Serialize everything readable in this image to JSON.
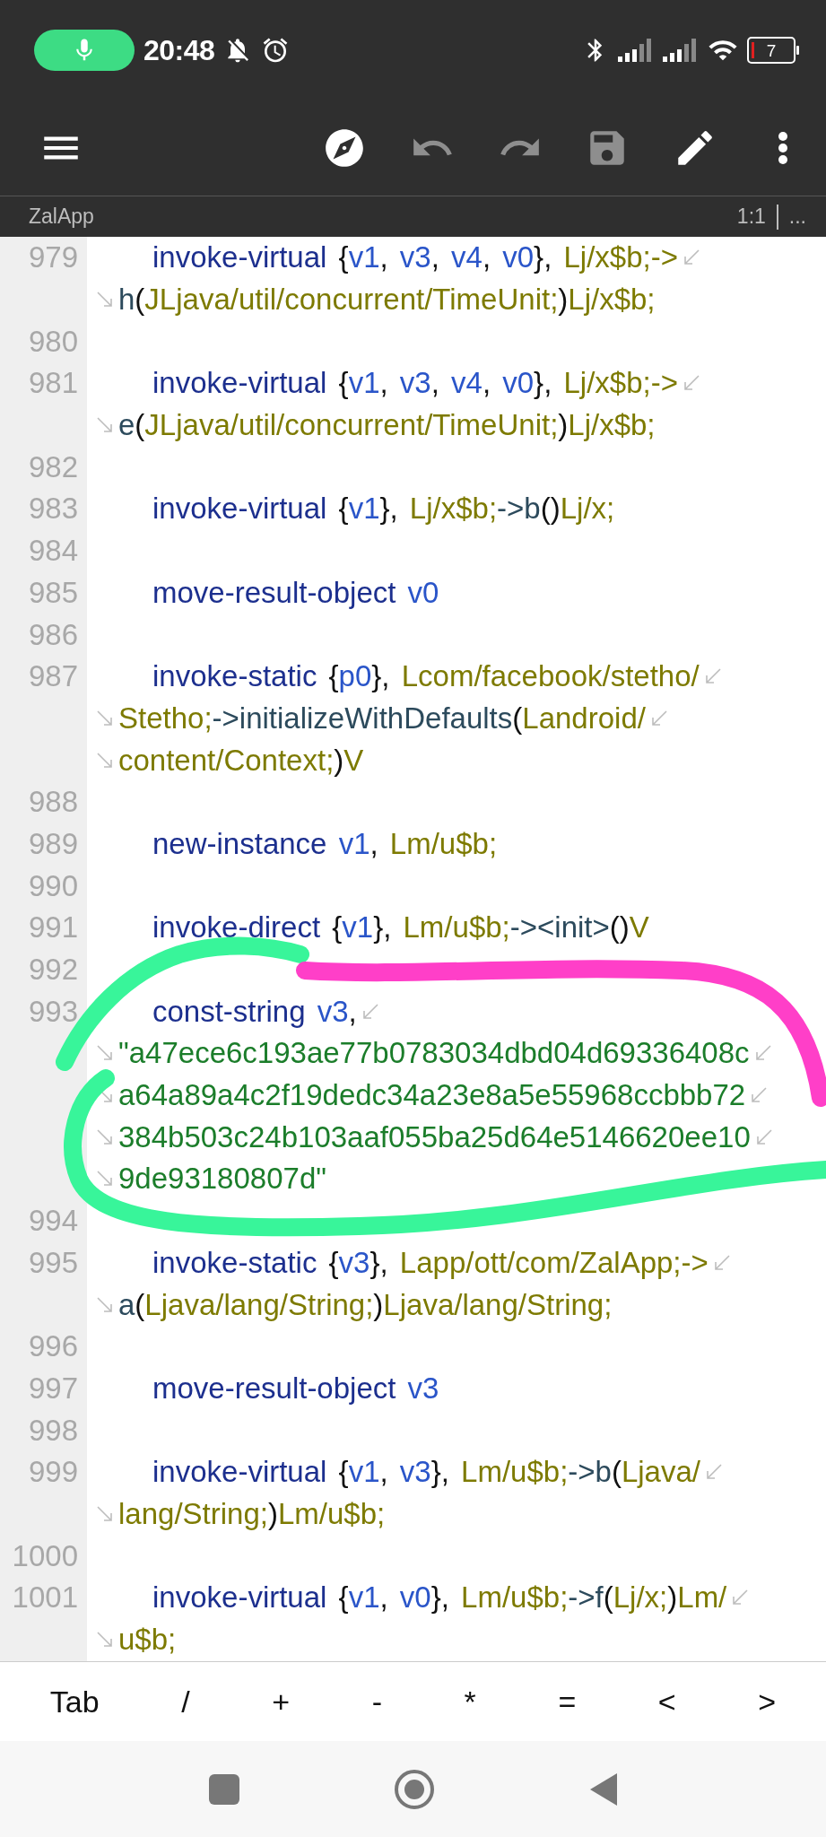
{
  "status_bar": {
    "time": "20:48",
    "battery": "7"
  },
  "toolbar": [
    {
      "kind": "menu",
      "disabled": false
    },
    {
      "kind": "compass",
      "disabled": false
    },
    {
      "kind": "undo",
      "disabled": true
    },
    {
      "kind": "redo",
      "disabled": true
    },
    {
      "kind": "save",
      "disabled": true
    },
    {
      "kind": "edit",
      "disabled": false
    },
    {
      "kind": "more",
      "disabled": false
    }
  ],
  "file_tab": {
    "title": "ZalApp",
    "position": "1:1",
    "more": "..."
  },
  "code": [
    {
      "number": "979",
      "rows": [
        "invoke-virtual {v1, v3, v4, v0}, Lj/x$b;->",
        "h(JLjava/util/concurrent/TimeUnit;)Lj/x$b;"
      ]
    },
    {
      "number": "980"
    },
    {
      "number": "981",
      "rows": [
        "invoke-virtual {v1, v3, v4, v0}, Lj/x$b;->",
        "e(JLjava/util/concurrent/TimeUnit;)Lj/x$b;"
      ]
    },
    {
      "number": "982"
    },
    {
      "number": "983",
      "rows": [
        "invoke-virtual {v1}, Lj/x$b;->b()Lj/x;"
      ]
    },
    {
      "number": "984"
    },
    {
      "number": "985",
      "rows": [
        "move-result-object v0"
      ]
    },
    {
      "number": "986"
    },
    {
      "number": "987",
      "rows": [
        "invoke-static {p0}, Lcom/facebook/stetho/",
        "Stetho;->initializeWithDefaults(Landroid/",
        "content/Context;)V"
      ]
    },
    {
      "number": "988"
    },
    {
      "number": "989",
      "rows": [
        "new-instance v1, Lm/u$b;"
      ]
    },
    {
      "number": "990"
    },
    {
      "number": "991",
      "rows": [
        "invoke-direct {v1}, Lm/u$b;-><init>()V"
      ]
    },
    {
      "number": "992"
    },
    {
      "number": "993",
      "rows": [
        "const-string v3,",
        "\"a47ece6c193ae77b0783034dbd04d69336408c",
        "a64a89a4c2f19dedc34a23e8a5e55968ccbbb72",
        "384b503c24b103aaf055ba25d64e5146620ee10",
        "9de93180807d\""
      ]
    },
    {
      "number": "994"
    },
    {
      "number": "995",
      "rows": [
        "invoke-static {v3}, Lapp/ott/com/ZalApp;->",
        "a(Ljava/lang/String;)Ljava/lang/String;"
      ]
    },
    {
      "number": "996"
    },
    {
      "number": "997",
      "rows": [
        "move-result-object v3"
      ]
    },
    {
      "number": "998"
    },
    {
      "number": "999",
      "rows": [
        "invoke-virtual {v1, v3}, Lm/u$b;->b(Ljava/",
        "lang/String;)Lm/u$b;"
      ]
    },
    {
      "number": "1000"
    },
    {
      "number": "1001",
      "rows": [
        "invoke-virtual {v1, v0}, Lm/u$b;->f(Lj/x;)Lm/",
        "u$b;"
      ]
    }
  ],
  "keys": [
    "Tab",
    "/",
    "+",
    "-",
    "*",
    "=",
    "<",
    ">"
  ]
}
